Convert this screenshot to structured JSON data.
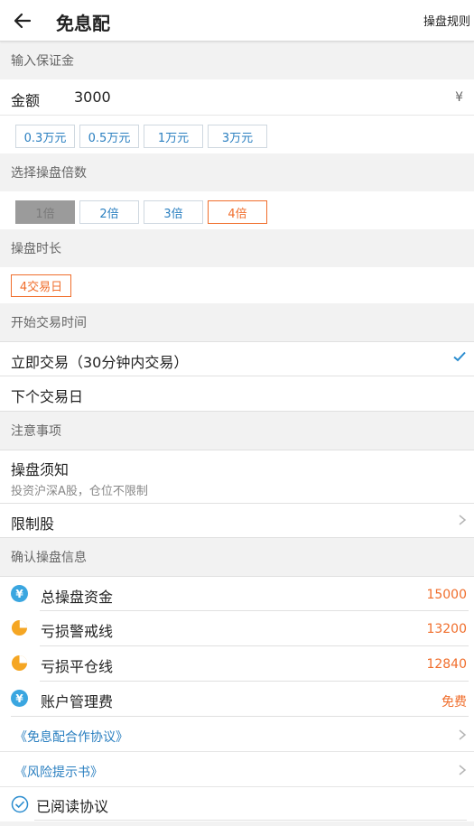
{
  "header": {
    "back_icon": "arrow-left-icon",
    "title": "免息配",
    "rules_label": "操盘规则"
  },
  "margin_section": {
    "label": "输入保证金",
    "amount_label": "金额",
    "amount_value": "3000",
    "currency_symbol": "¥",
    "presets": [
      "0.3万元",
      "0.5万元",
      "1万元",
      "3万元"
    ]
  },
  "multiplier_section": {
    "label": "选择操盘倍数",
    "options": [
      "1倍",
      "2倍",
      "3倍",
      "4倍"
    ],
    "disabled": "1倍",
    "selected": "4倍"
  },
  "duration_section": {
    "label": "操盘时长",
    "value": "4交易日"
  },
  "start_section": {
    "label": "开始交易时间",
    "option_now": "立即交易（30分钟内交易）",
    "option_next": "下个交易日",
    "selected": "立即交易（30分钟内交易）"
  },
  "notice_section": {
    "label": "注意事项",
    "title": "操盘须知",
    "subtitle": "投资沪深A股，仓位不限制",
    "restricted_label": "限制股"
  },
  "confirm_section": {
    "label": "确认操盘信息",
    "items": [
      {
        "label": "总操盘资金",
        "value": "15000",
        "icon": "yen-circle-icon",
        "icon_color": "#3aa6e0"
      },
      {
        "label": "亏损警戒线",
        "value": "13200",
        "icon": "pie-chart-icon",
        "icon_color": "#f5a623"
      },
      {
        "label": "亏损平仓线",
        "value": "12840",
        "icon": "pie-chart-icon",
        "icon_color": "#f5a623"
      },
      {
        "label": "账户管理费",
        "value": "免费",
        "icon": "yen-circle-icon",
        "icon_color": "#3aa6e0"
      }
    ],
    "agreement_link": "《免息配合作协议》",
    "risk_link": "《风险提示书》",
    "read_label": "已阅读协议"
  },
  "colors": {
    "accent_orange": "#f06e2c",
    "link_blue": "#2a7fc0",
    "icon_blue": "#3aa6e0",
    "icon_orange": "#f5a623"
  }
}
